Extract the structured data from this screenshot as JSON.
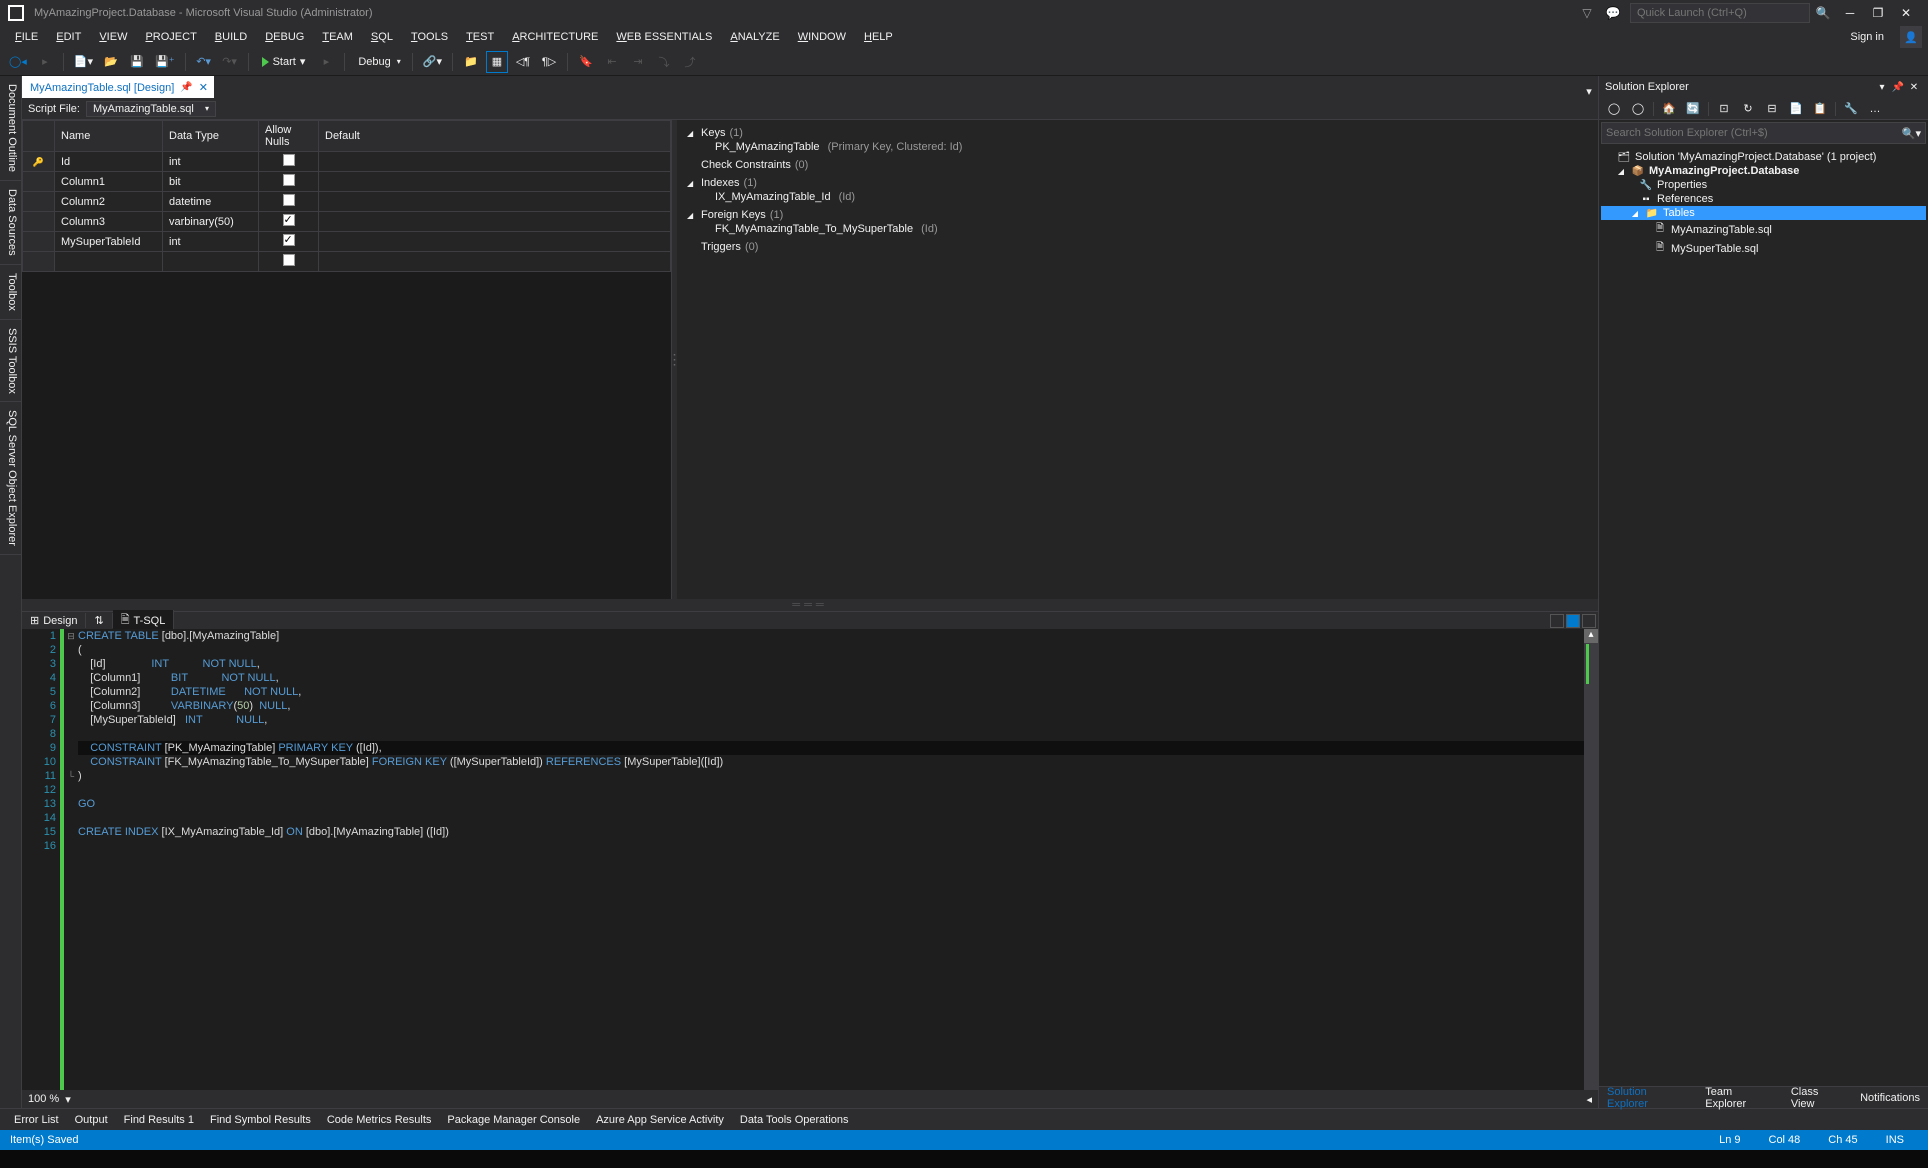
{
  "title": "MyAmazingProject.Database - Microsoft Visual Studio  (Administrator)",
  "quickLaunch": "Quick Launch (Ctrl+Q)",
  "menu": [
    "FILE",
    "EDIT",
    "VIEW",
    "PROJECT",
    "BUILD",
    "DEBUG",
    "TEAM",
    "SQL",
    "TOOLS",
    "TEST",
    "ARCHITECTURE",
    "WEB ESSENTIALS",
    "ANALYZE",
    "WINDOW",
    "HELP"
  ],
  "signIn": "Sign in",
  "toolbar": {
    "start": "Start",
    "config": "Debug"
  },
  "leftTabs": [
    "Document Outline",
    "Data Sources",
    "Toolbox",
    "SSIS Toolbox",
    "SQL Server Object Explorer"
  ],
  "editorTab": "MyAmazingTable.sql [Design]",
  "scriptFile": {
    "label": "Script File:",
    "value": "MyAmazingTable.sql"
  },
  "gridHeaders": [
    "Name",
    "Data Type",
    "Allow Nulls",
    "Default"
  ],
  "gridRows": [
    {
      "key": true,
      "name": "Id",
      "type": "int",
      "nulls": false
    },
    {
      "key": false,
      "name": "Column1",
      "type": "bit",
      "nulls": false
    },
    {
      "key": false,
      "name": "Column2",
      "type": "datetime",
      "nulls": false
    },
    {
      "key": false,
      "name": "Column3",
      "type": "varbinary(50)",
      "nulls": true
    },
    {
      "key": false,
      "name": "MySuperTableId",
      "type": "int",
      "nulls": true
    }
  ],
  "props": {
    "keys": {
      "label": "Keys",
      "count": "(1)",
      "items": [
        {
          "name": "PK_MyAmazingTable",
          "desc": "(Primary Key, Clustered: Id)"
        }
      ]
    },
    "check": {
      "label": "Check Constraints",
      "count": "(0)"
    },
    "indexes": {
      "label": "Indexes",
      "count": "(1)",
      "items": [
        {
          "name": "IX_MyAmazingTable_Id",
          "desc": "(Id)"
        }
      ]
    },
    "fkeys": {
      "label": "Foreign Keys",
      "count": "(1)",
      "items": [
        {
          "name": "FK_MyAmazingTable_To_MySuperTable",
          "desc": "(Id)"
        }
      ]
    },
    "triggers": {
      "label": "Triggers",
      "count": "(0)"
    }
  },
  "designTabs": {
    "design": "Design",
    "tsql": "T-SQL"
  },
  "sql": {
    "lines": [
      {
        "n": 1,
        "fold": "⊟",
        "t": [
          {
            "k": "kw",
            "v": "CREATE TABLE"
          },
          {
            "v": " [dbo].[MyAmazingTable]"
          }
        ]
      },
      {
        "n": 2,
        "t": [
          {
            "v": "("
          }
        ]
      },
      {
        "n": 3,
        "t": [
          {
            "v": "    [Id]               "
          },
          {
            "k": "kw",
            "v": "INT           "
          },
          {
            "k": "kw",
            "v": "NOT NULL"
          },
          {
            "v": ","
          }
        ]
      },
      {
        "n": 4,
        "t": [
          {
            "v": "    [Column1]          "
          },
          {
            "k": "kw",
            "v": "BIT           "
          },
          {
            "k": "kw",
            "v": "NOT NULL"
          },
          {
            "v": ","
          }
        ]
      },
      {
        "n": 5,
        "t": [
          {
            "v": "    [Column2]          "
          },
          {
            "k": "kw",
            "v": "DATETIME      "
          },
          {
            "k": "kw",
            "v": "NOT NULL"
          },
          {
            "v": ","
          }
        ]
      },
      {
        "n": 6,
        "t": [
          {
            "v": "    [Column3]          "
          },
          {
            "k": "kw",
            "v": "VARBINARY"
          },
          {
            "v": "("
          },
          {
            "k": "num",
            "v": "50"
          },
          {
            "v": ")  "
          },
          {
            "k": "kw",
            "v": "NULL"
          },
          {
            "v": ","
          }
        ]
      },
      {
        "n": 7,
        "t": [
          {
            "v": "    [MySuperTableId]   "
          },
          {
            "k": "kw",
            "v": "INT           "
          },
          {
            "k": "kw",
            "v": "NULL"
          },
          {
            "v": ","
          }
        ]
      },
      {
        "n": 8,
        "t": [
          {
            "v": ""
          }
        ]
      },
      {
        "n": 9,
        "hl": true,
        "t": [
          {
            "v": "    "
          },
          {
            "k": "kw",
            "v": "CONSTRAINT"
          },
          {
            "v": " [PK_MyAmazingTable] "
          },
          {
            "k": "kw",
            "v": "PRIMARY KEY"
          },
          {
            "v": " ([Id]),"
          }
        ]
      },
      {
        "n": 10,
        "t": [
          {
            "v": "    "
          },
          {
            "k": "kw",
            "v": "CONSTRAINT"
          },
          {
            "v": " [FK_MyAmazingTable_To_MySuperTable] "
          },
          {
            "k": "kw",
            "v": "FOREIGN KEY"
          },
          {
            "v": " ([MySuperTableId]) "
          },
          {
            "k": "kw",
            "v": "REFERENCES"
          },
          {
            "v": " [MySuperTable]([Id])"
          }
        ]
      },
      {
        "n": 11,
        "fold": "└",
        "t": [
          {
            "v": ")"
          }
        ]
      },
      {
        "n": 12,
        "t": [
          {
            "v": ""
          }
        ]
      },
      {
        "n": 13,
        "t": [
          {
            "k": "kw",
            "v": "GO"
          }
        ]
      },
      {
        "n": 14,
        "t": [
          {
            "v": ""
          }
        ]
      },
      {
        "n": 15,
        "t": [
          {
            "k": "kw",
            "v": "CREATE INDEX"
          },
          {
            "v": " [IX_MyAmazingTable_Id] "
          },
          {
            "k": "kw",
            "v": "ON"
          },
          {
            "v": " [dbo].[MyAmazingTable] ([Id])"
          }
        ]
      },
      {
        "n": 16,
        "t": [
          {
            "v": ""
          }
        ]
      }
    ],
    "zoom": "100 %"
  },
  "solExp": {
    "title": "Solution Explorer",
    "search": "Search Solution Explorer (Ctrl+$)",
    "tree": {
      "solution": "Solution 'MyAmazingProject.Database' (1 project)",
      "project": "MyAmazingProject.Database",
      "properties": "Properties",
      "references": "References",
      "tables": "Tables",
      "file1": "MyAmazingTable.sql",
      "file2": "MySuperTable.sql"
    },
    "tabs": [
      "Solution Explorer",
      "Team Explorer",
      "Class View",
      "Notifications"
    ]
  },
  "errorTabs": [
    "Error List",
    "Output",
    "Find Results 1",
    "Find Symbol Results",
    "Code Metrics Results",
    "Package Manager Console",
    "Azure App Service Activity",
    "Data Tools Operations"
  ],
  "status": {
    "msg": "Item(s) Saved",
    "ln": "Ln 9",
    "col": "Col 48",
    "ch": "Ch 45",
    "ins": "INS"
  }
}
